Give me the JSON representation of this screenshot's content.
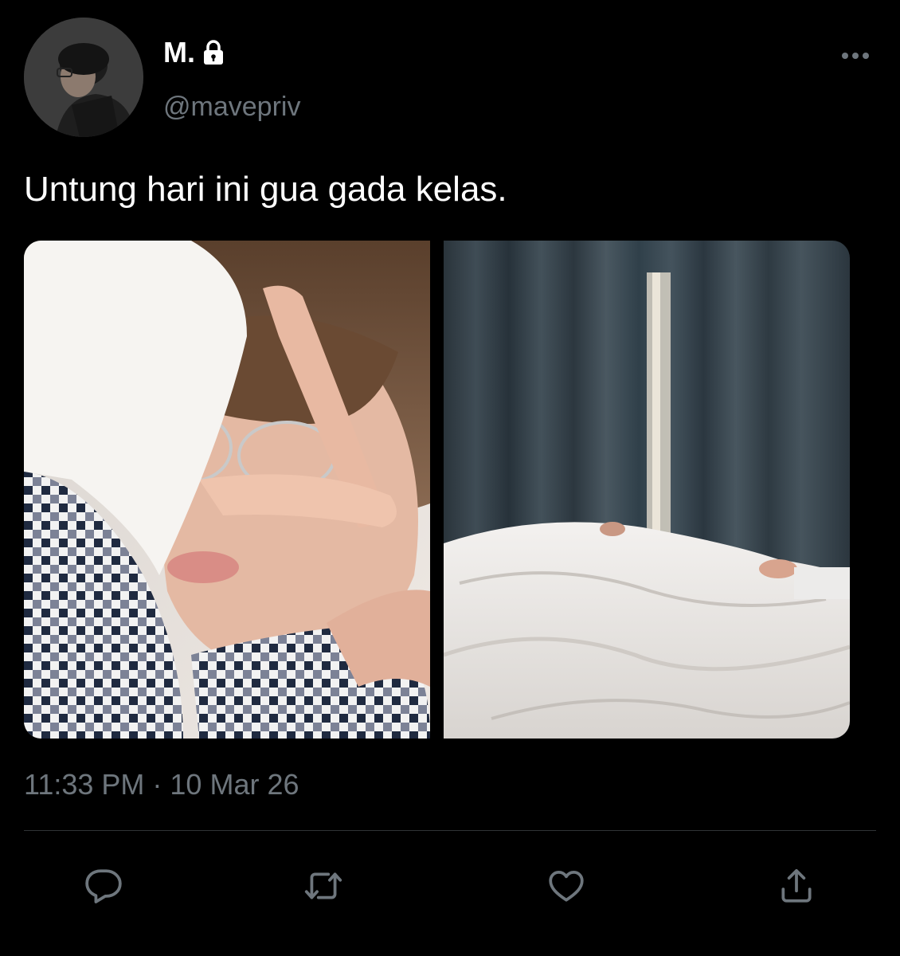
{
  "tweet": {
    "display_name": "M.",
    "username": "@mavepriv",
    "text": "Untung hari ini gua gada kelas.",
    "timestamp": "11:33 PM · 10 Mar 26",
    "is_protected": true,
    "media": [
      {
        "name": "selfie-photo"
      },
      {
        "name": "bed-curtain-photo"
      }
    ]
  },
  "icons": {
    "lock": "lock-icon",
    "more": "more-icon",
    "reply": "reply-icon",
    "retweet": "retweet-icon",
    "like": "like-icon",
    "share": "share-icon"
  },
  "colors": {
    "background": "#000000",
    "text_primary": "#ffffff",
    "text_secondary": "#6e767d",
    "divider": "#2f3336",
    "icon": "#6e767d"
  }
}
